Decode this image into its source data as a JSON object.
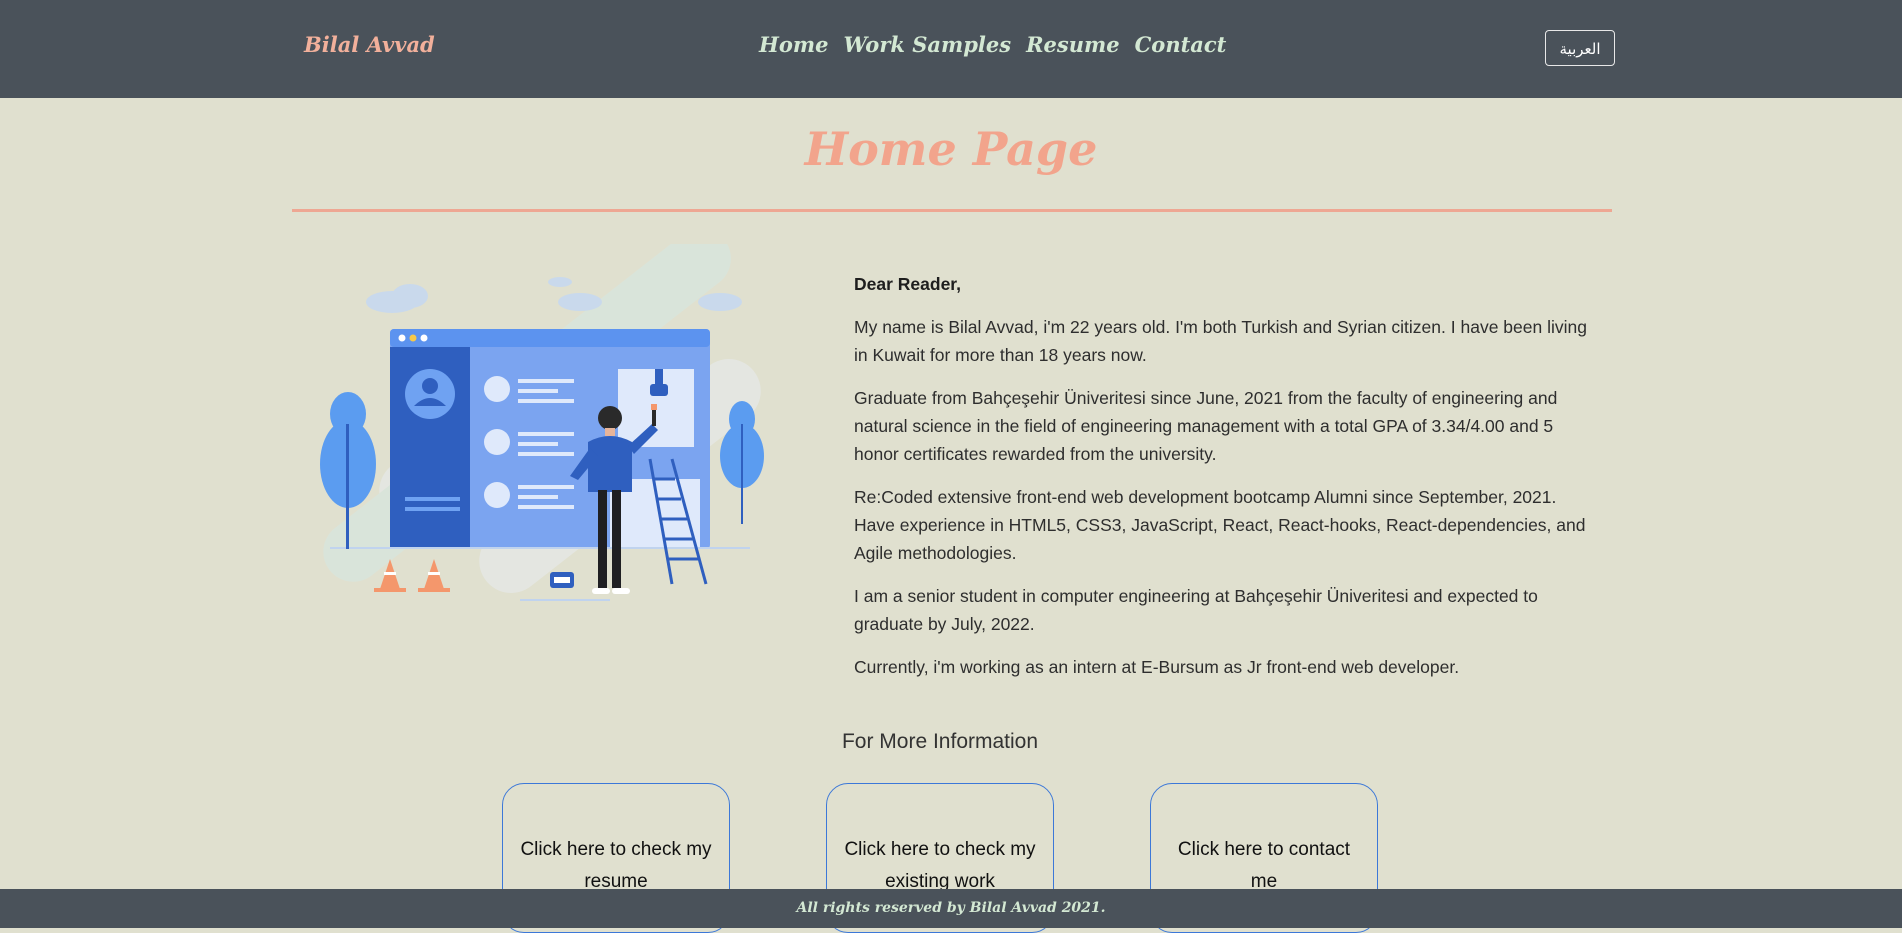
{
  "nav": {
    "brand": "Bilal Avvad",
    "links": [
      "Home",
      "Work Samples",
      "Resume",
      "Contact"
    ],
    "language_button": "العربية"
  },
  "page_title": "Home Page",
  "content": {
    "greeting": "Dear Reader,",
    "paragraphs": [
      "My name is Bilal Avvad, i'm 22 years old. I'm both Turkish and Syrian citizen. I have been living in Kuwait for more than 18 years now.",
      "Graduate from Bahçeşehir Üniveritesi since June, 2021 from the faculty of engineering and natural science in the field of engineering management with a total GPA of 3.34/4.00 and 5 honor certificates rewarded from the university.",
      "Re:Coded extensive front-end web development bootcamp Alumni since September, 2021. Have experience in HTML5, CSS3, JavaScript, React, React-hooks, React-dependencies, and Agile methodologies.",
      "I am a senior student in computer engineering at Bahçeşehir Üniveritesi and expected to graduate by July, 2022.",
      "Currently, i'm working as an intern at E-Bursum as Jr front-end web developer."
    ]
  },
  "more_info": {
    "heading": "For More Information",
    "cards": [
      "Click here to check my resume",
      "Click here to check my existing work",
      "Click here to contact me"
    ]
  },
  "footer": "All rights reserved by Bilal Avvad 2021.",
  "colors": {
    "navbar_bg": "#4a525a",
    "page_bg": "#e0e0cf",
    "accent_salmon": "#f2a48c",
    "nav_link": "#d3e8d3",
    "card_border": "#3c78d8"
  }
}
